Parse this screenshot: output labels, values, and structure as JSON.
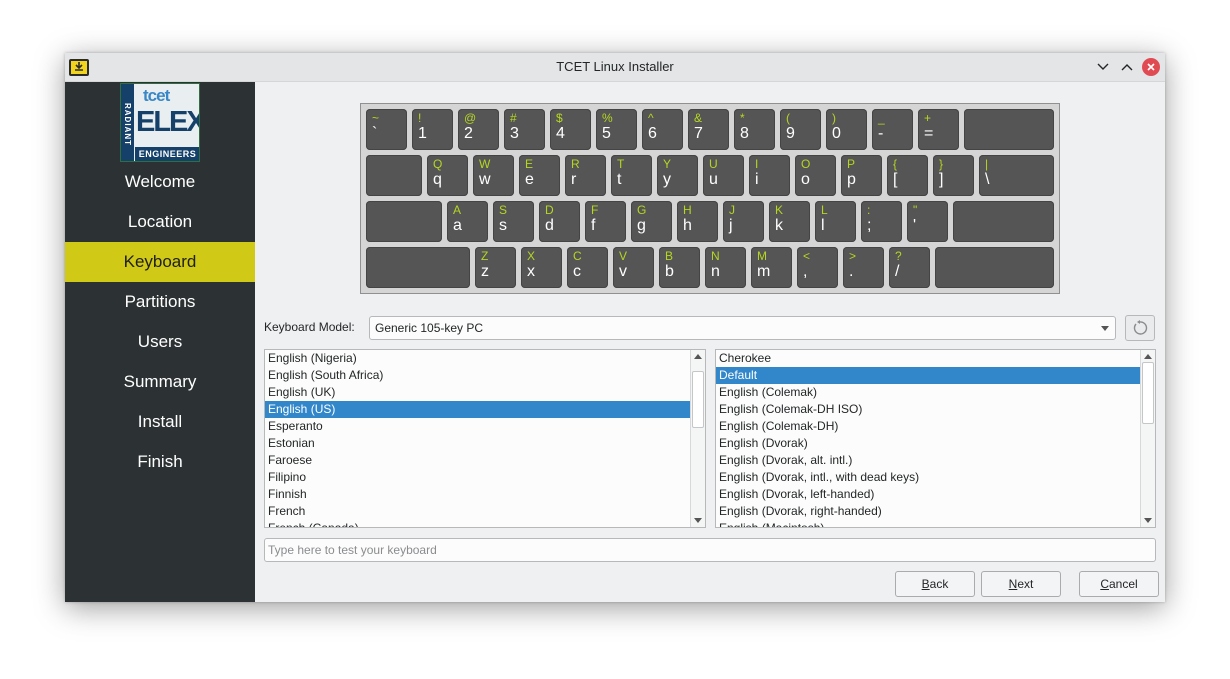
{
  "window": {
    "title": "TCET Linux Installer",
    "app_icon": "download-folder-icon",
    "controls": [
      "minimize-icon",
      "maximize-icon",
      "close-icon"
    ]
  },
  "sidebar": {
    "logo": {
      "side_text": "RADIANT",
      "top_text": "tcet",
      "main_text": "ELEX",
      "bottom_text": "ENGINEERS"
    },
    "items": [
      {
        "label": "Welcome",
        "active": false
      },
      {
        "label": "Location",
        "active": false
      },
      {
        "label": "Keyboard",
        "active": true
      },
      {
        "label": "Partitions",
        "active": false
      },
      {
        "label": "Users",
        "active": false
      },
      {
        "label": "Summary",
        "active": false
      },
      {
        "label": "Install",
        "active": false
      },
      {
        "label": "Finish",
        "active": false
      }
    ]
  },
  "keyboard_preview": {
    "rows": [
      [
        [
          "~",
          "`"
        ],
        [
          "!",
          "1"
        ],
        [
          "@",
          "2"
        ],
        [
          "#",
          "3"
        ],
        [
          "$",
          "4"
        ],
        [
          "%",
          "5"
        ],
        [
          "^",
          "6"
        ],
        [
          "&",
          "7"
        ],
        [
          "*",
          "8"
        ],
        [
          "(",
          "9"
        ],
        [
          ")",
          "0"
        ],
        [
          "_",
          "-"
        ],
        [
          "+",
          "="
        ],
        [
          "",
          ""
        ]
      ],
      [
        [
          "",
          ""
        ],
        [
          "Q",
          "q"
        ],
        [
          "W",
          "w"
        ],
        [
          "E",
          "e"
        ],
        [
          "R",
          "r"
        ],
        [
          "T",
          "t"
        ],
        [
          "Y",
          "y"
        ],
        [
          "U",
          "u"
        ],
        [
          "I",
          "i"
        ],
        [
          "O",
          "o"
        ],
        [
          "P",
          "p"
        ],
        [
          "{",
          "["
        ],
        [
          "}",
          "]"
        ],
        [
          "|",
          "\\"
        ]
      ],
      [
        [
          "",
          ""
        ],
        [
          "A",
          "a"
        ],
        [
          "S",
          "s"
        ],
        [
          "D",
          "d"
        ],
        [
          "F",
          "f"
        ],
        [
          "G",
          "g"
        ],
        [
          "H",
          "h"
        ],
        [
          "J",
          "j"
        ],
        [
          "K",
          "k"
        ],
        [
          "L",
          "l"
        ],
        [
          ":",
          ";"
        ],
        [
          "\"",
          "'"
        ],
        [
          "",
          ""
        ]
      ],
      [
        [
          "",
          ""
        ],
        [
          "Z",
          "z"
        ],
        [
          "X",
          "x"
        ],
        [
          "C",
          "c"
        ],
        [
          "V",
          "v"
        ],
        [
          "B",
          "b"
        ],
        [
          "N",
          "n"
        ],
        [
          "M",
          "m"
        ],
        [
          "<",
          ","
        ],
        [
          ">",
          "."
        ],
        [
          "?",
          "/"
        ],
        [
          "",
          ""
        ]
      ]
    ]
  },
  "model": {
    "label": "Keyboard Model:",
    "value": "Generic 105-key PC",
    "reset_icon": "reset-icon"
  },
  "layouts": {
    "items": [
      "English (Nigeria)",
      "English (South Africa)",
      "English (UK)",
      "English (US)",
      "Esperanto",
      "Estonian",
      "Faroese",
      "Filipino",
      "Finnish",
      "French",
      "French (Canada)"
    ],
    "selected": "English (US)"
  },
  "variants": {
    "items": [
      "Cherokee",
      "Default",
      "English (Colemak)",
      "English (Colemak-DH ISO)",
      "English (Colemak-DH)",
      "English (Dvorak)",
      "English (Dvorak, alt. intl.)",
      "English (Dvorak, intl., with dead keys)",
      "English (Dvorak, left-handed)",
      "English (Dvorak, right-handed)",
      "English (Macintosh)"
    ],
    "selected": "Default"
  },
  "test": {
    "placeholder": "Type here to test your keyboard",
    "value": ""
  },
  "buttons": {
    "back": {
      "mnemonic": "B",
      "rest": "ack"
    },
    "next": {
      "mnemonic": "N",
      "rest": "ext"
    },
    "cancel": {
      "mnemonic": "C",
      "rest": "ancel"
    }
  },
  "colors": {
    "sidebar_bg": "#2c3133",
    "active_item": "#d0c915",
    "key_bg": "#555555",
    "shift_legend": "#b4d623",
    "selection": "#3287ca"
  }
}
